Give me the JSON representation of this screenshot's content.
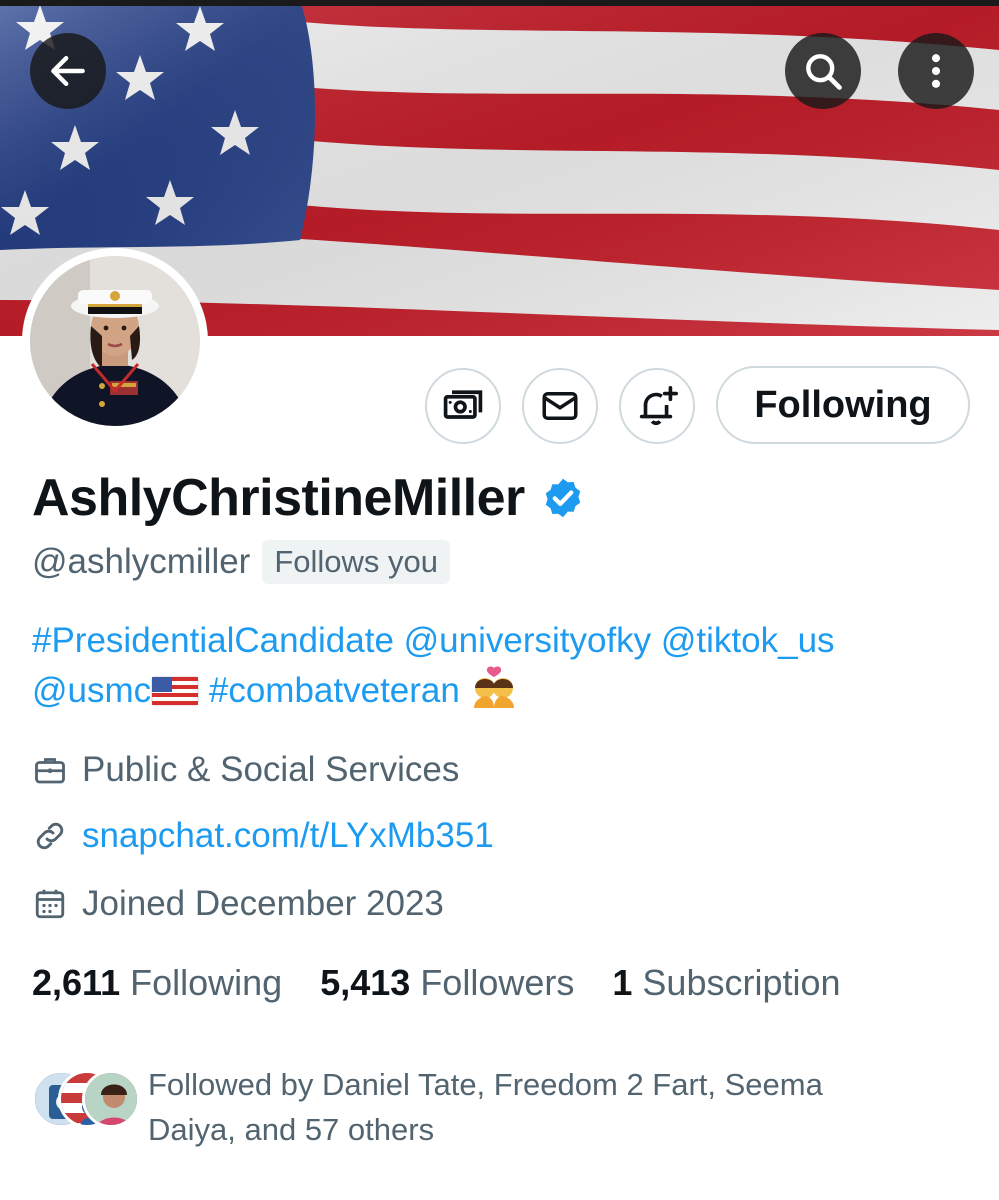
{
  "profile": {
    "display_name": "AshlyChristineMiller",
    "handle": "@ashlycmiller",
    "follows_you_badge": "Follows you",
    "bio_line1": "#PresidentialCandidate @universityofky @tiktok_us",
    "bio_line2a": "@usmc",
    "bio_line2b": " #combatveteran ",
    "category": "Public & Social Services",
    "link": "snapchat.com/t/LYxMb351",
    "joined": "Joined December 2023"
  },
  "actions": {
    "following_label": "Following"
  },
  "stats": [
    {
      "number": "2,611",
      "label": "Following"
    },
    {
      "number": "5,413",
      "label": "Followers"
    },
    {
      "number": "1",
      "label": "Subscription"
    }
  ],
  "followed_by": "Followed by Daniel Tate, Freedom 2 Fart, Seema Daiya, and 57 others",
  "icons": {
    "back": "arrow-left-icon",
    "search": "search-icon",
    "more": "more-vertical-icon",
    "tip": "money-icon",
    "message": "envelope-icon",
    "notify": "bell-plus-icon",
    "verified": "verified-badge-icon",
    "category": "briefcase-icon",
    "link": "link-icon",
    "joined": "calendar-icon"
  },
  "colors": {
    "accent": "#1d9bf0",
    "text_primary": "#0f1419",
    "text_secondary": "#536471",
    "border": "#cfd9de"
  }
}
